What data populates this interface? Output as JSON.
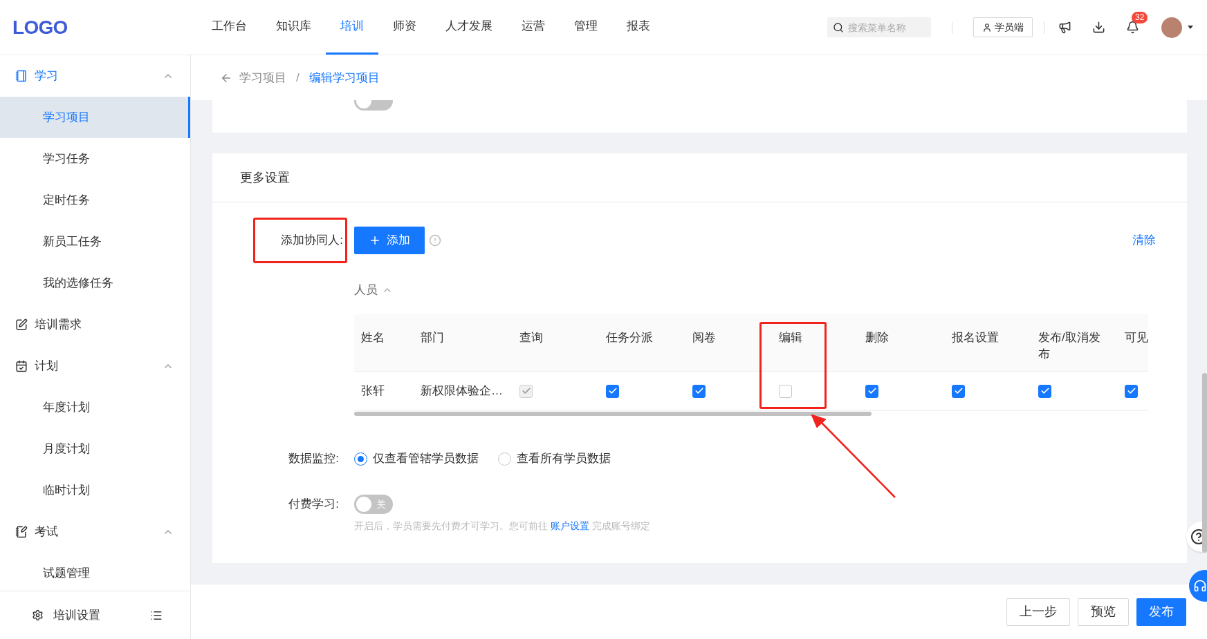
{
  "header": {
    "logo": "LOGO",
    "nav": [
      {
        "label": "工作台",
        "selected": false
      },
      {
        "label": "知识库",
        "selected": false
      },
      {
        "label": "培训",
        "selected": true
      },
      {
        "label": "师资",
        "selected": false
      },
      {
        "label": "人才发展",
        "selected": false
      },
      {
        "label": "运营",
        "selected": false
      },
      {
        "label": "管理",
        "selected": false
      },
      {
        "label": "报表",
        "selected": false
      }
    ],
    "search": {
      "placeholder": "搜索菜单名称"
    },
    "role_button": "学员端",
    "notification_count": "32"
  },
  "sidebar": {
    "groups": [
      {
        "label": "学习",
        "expanded": true,
        "selected": true,
        "items": [
          {
            "label": "学习项目",
            "selected": true
          },
          {
            "label": "学习任务",
            "selected": false
          },
          {
            "label": "定时任务",
            "selected": false
          },
          {
            "label": "新员工任务",
            "selected": false
          },
          {
            "label": "我的选修任务",
            "selected": false
          }
        ]
      },
      {
        "label": "培训需求",
        "selected": false
      },
      {
        "label": "计划",
        "expanded": true,
        "selected": false,
        "items": [
          {
            "label": "年度计划",
            "selected": false
          },
          {
            "label": "月度计划",
            "selected": false
          },
          {
            "label": "临时计划",
            "selected": false
          }
        ]
      },
      {
        "label": "考试",
        "expanded": true,
        "selected": false,
        "items": [
          {
            "label": "试题管理",
            "selected": false
          }
        ]
      }
    ],
    "settings": "培训设置"
  },
  "breadcrumb": [
    "学习项目",
    "编辑学习项目"
  ],
  "breadcrumb_separator": "/",
  "top_card": {
    "switch_on": false
  },
  "section": {
    "title": "更多设置",
    "collaborator": {
      "label": "添加协同人:",
      "add_button": "添加",
      "clear_link": "清除"
    },
    "people": {
      "label": "人员",
      "expanded": true
    },
    "table": {
      "columns": [
        "姓名",
        "部门",
        "查询",
        "任务分派",
        "阅卷",
        "编辑",
        "删除",
        "报名设置",
        "发布/取消发布",
        "可见"
      ],
      "rows": [
        {
          "name": "张轩",
          "department": "新权限体验企…",
          "permissions": [
            {
              "checked": true,
              "disabled": true
            },
            {
              "checked": true,
              "disabled": false
            },
            {
              "checked": true,
              "disabled": false
            },
            {
              "checked": false,
              "disabled": false
            },
            {
              "checked": true,
              "disabled": false
            },
            {
              "checked": true,
              "disabled": false
            },
            {
              "checked": true,
              "disabled": false
            },
            {
              "checked": true,
              "disabled": false
            }
          ]
        }
      ]
    },
    "data_monitor": {
      "label": "数据监控:",
      "options": [
        {
          "label": "仅查看管辖学员数据",
          "selected": true
        },
        {
          "label": "查看所有学员数据",
          "selected": false
        }
      ]
    },
    "paid": {
      "label": "付费学习:",
      "on": false,
      "switch_text": "关",
      "hint_before": "开启后，学员需要先付费才可学习。您可前往",
      "hint_link": "账户设置",
      "hint_after": "完成账号绑定"
    }
  },
  "footer": {
    "buttons": [
      {
        "label": "上一步",
        "kind": "default"
      },
      {
        "label": "预览",
        "kind": "default"
      },
      {
        "label": "发布",
        "kind": "primary"
      }
    ]
  }
}
